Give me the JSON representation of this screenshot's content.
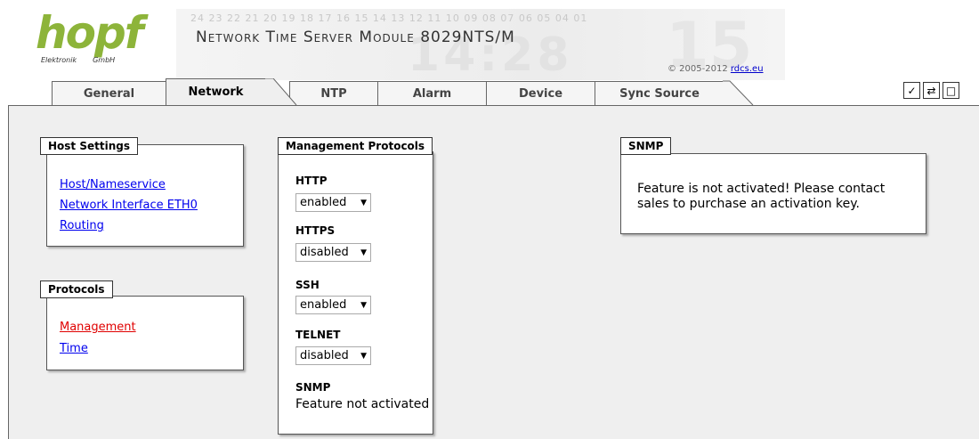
{
  "header": {
    "logo_word": "hopf",
    "logo_sub_left": "Elektronik",
    "logo_sub_right": "GmbH",
    "module_title": "Network Time Server Module 8029NTS/M",
    "copyright_prefix": "© 2005-2012 ",
    "copyright_link": "rdcs.eu",
    "background_digits": "24 23 22 21 20 19 18 17 16 15 14 13 12 11 10 09 08 07 06 05 04 01",
    "background_time": "14:28",
    "background_glyph": "15"
  },
  "tabs": [
    {
      "label": "General",
      "active": false
    },
    {
      "label": "Network",
      "active": true
    },
    {
      "label": "NTP",
      "active": false
    },
    {
      "label": "Alarm",
      "active": false
    },
    {
      "label": "Device",
      "active": false
    },
    {
      "label": "Sync Source",
      "active": false
    }
  ],
  "toolbar": {
    "apply_icon": "✓",
    "reload_icon": "⇄",
    "save_icon": "□"
  },
  "host_settings": {
    "title": "Host Settings",
    "links": [
      "Host/Nameservice",
      "Network Interface ETH0",
      "Routing"
    ]
  },
  "protocols": {
    "title": "Protocols",
    "links": [
      "Management",
      "Time"
    ],
    "active_index": 0
  },
  "management": {
    "title": "Management Protocols",
    "fields": [
      {
        "label": "HTTP",
        "value": "enabled"
      },
      {
        "label": "HTTPS",
        "value": "disabled"
      },
      {
        "label": "SSH",
        "value": "enabled"
      },
      {
        "label": "TELNET",
        "value": "disabled"
      }
    ],
    "snmp_label": "SNMP",
    "snmp_text": "Feature not activated"
  },
  "snmp_panel": {
    "title": "SNMP",
    "message_line1": "Feature is not activated! Please contact",
    "message_line2": "sales to purchase an activation key."
  },
  "colors": {
    "logo_green": "#8db43a",
    "link_blue": "#0000ee",
    "link_active_red": "#e00000",
    "content_bg": "#efefef"
  }
}
